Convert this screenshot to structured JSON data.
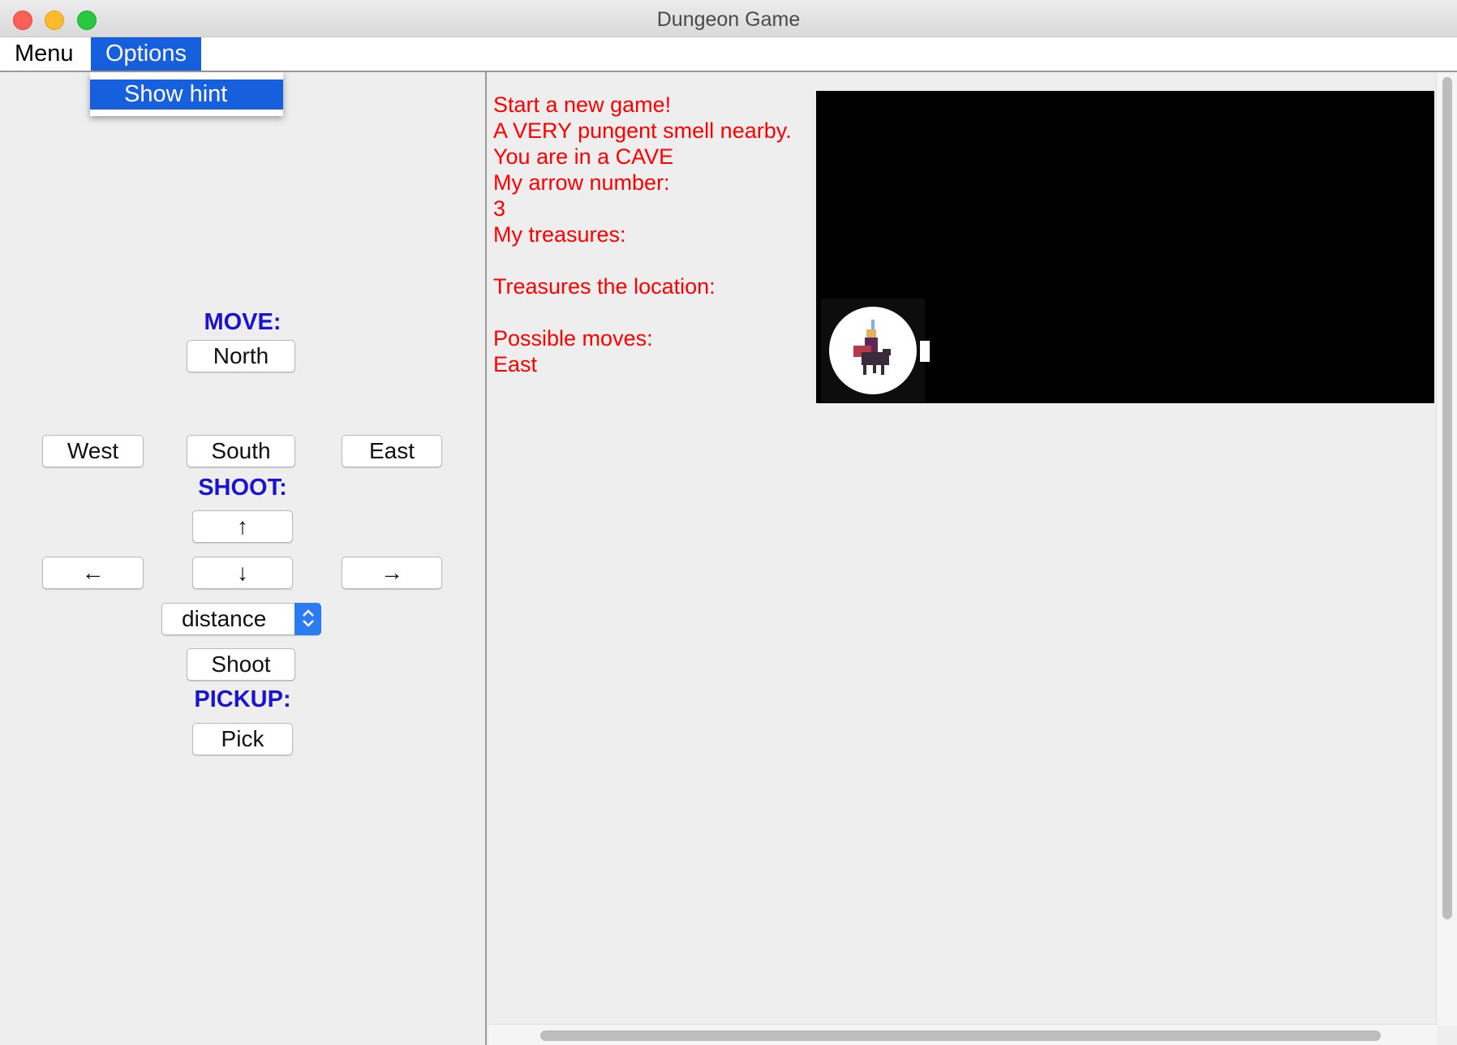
{
  "window": {
    "title": "Dungeon Game"
  },
  "menubar": {
    "items": [
      "Menu",
      "Options"
    ]
  },
  "options_menu": {
    "items": [
      "Show hint"
    ]
  },
  "controls": {
    "move_label": "MOVE:",
    "north": "North",
    "west": "West",
    "south": "South",
    "east": "East",
    "shoot_label": "SHOOT:",
    "shoot_up": "↑",
    "shoot_left": "←",
    "shoot_down": "↓",
    "shoot_right": "→",
    "distance_select": "distance",
    "shoot_button": "Shoot",
    "pickup_label": "PICKUP:",
    "pick_button": "Pick"
  },
  "status": {
    "lines": [
      "Start a new game!",
      "A VERY pungent smell nearby.",
      "You are in a CAVE",
      "My arrow number:",
      "3",
      "My treasures:",
      "",
      "Treasures the location:",
      "",
      "Possible moves:",
      "East"
    ]
  },
  "colors": {
    "accent": "#1660dd",
    "status_text": "#ff0000",
    "section_label": "#1a14cf",
    "map_background": "#000000"
  },
  "icons": [
    "player-knight-icon"
  ]
}
